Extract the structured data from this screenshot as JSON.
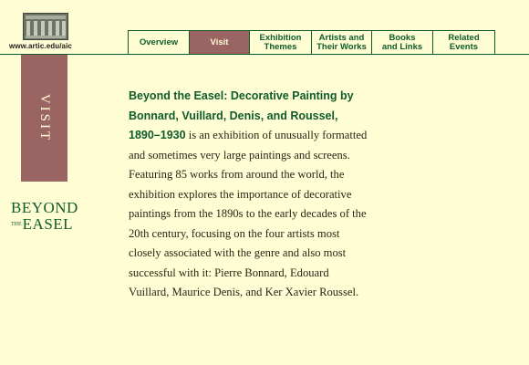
{
  "header": {
    "site_url": "www.artic.edu/aic"
  },
  "nav": {
    "items": [
      {
        "label": "Overview",
        "active": false
      },
      {
        "label": "Visit",
        "active": true
      },
      {
        "label": "Exhibition\nThemes",
        "active": false
      },
      {
        "label": "Artists and\nTheir Works",
        "active": false
      },
      {
        "label": "Books\nand Links",
        "active": false
      },
      {
        "label": "Related\nEvents",
        "active": false
      }
    ]
  },
  "sidebar": {
    "section_label": "VISIT",
    "exhibit_logo": {
      "line1": "BEYOND",
      "the": "THE",
      "line2": "EASEL"
    }
  },
  "main": {
    "title": "Beyond the Easel: Decorative Painting by Bonnard, Vuillard, Denis, and Roussel, 1890–1930",
    "body": " is an exhibition of unusually formatted and sometimes very large paintings and screens. Featuring 85 works from around the world, the exhibition explores the importance of decorative paintings from the 1890s to the early decades of the 20th century, focusing on the four artists most closely associated with the genre and also most successful with it: Pierre Bonnard, Edouard Vuillard, Maurice Denis, and Ker Xavier Roussel."
  },
  "colors": {
    "background": "#fefdd3",
    "accent_green": "#0f5b2b",
    "accent_mauve": "#9a6462"
  }
}
